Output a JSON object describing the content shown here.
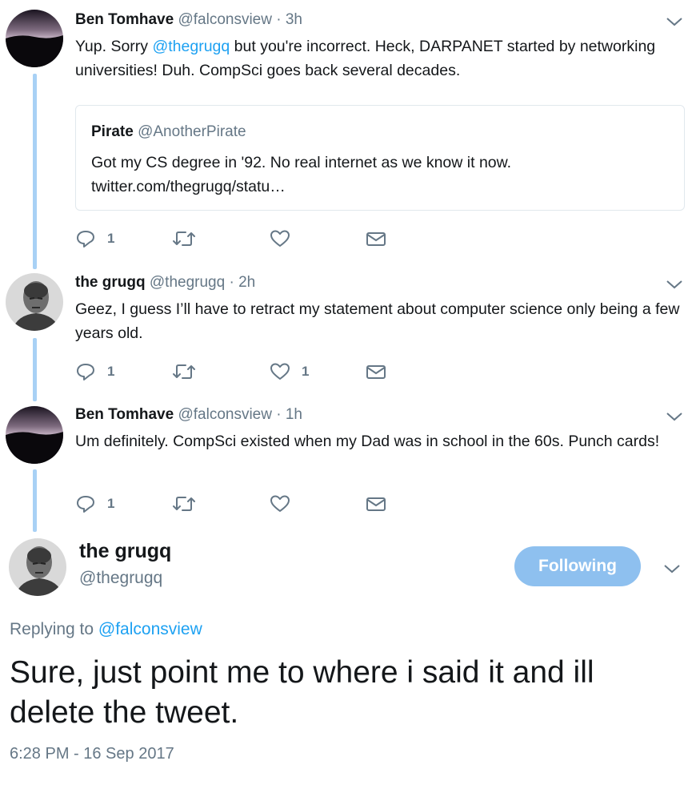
{
  "thread": [
    {
      "name": "Ben Tomhave",
      "handle": "@falconsview",
      "dot": "·",
      "time": "3h",
      "text_before": "Yup. Sorry ",
      "mention": "@thegrugq",
      "text_after": " but you're incorrect. Heck, DARPANET started by networking universities! Duh. CompSci goes back several decades.",
      "quoted": {
        "name": "Pirate",
        "handle": "@AnotherPirate",
        "text": "Got my CS degree in '92. No real internet as we know it now. twitter.com/thegrugq/statu…"
      },
      "actions": {
        "replies": "1",
        "retweets": "",
        "likes": ""
      }
    },
    {
      "name": "the grugq",
      "handle": "@thegrugq",
      "dot": "·",
      "time": "2h",
      "text": "Geez, I guess I’ll have to retract my statement about computer science only being a few years old.",
      "actions": {
        "replies": "1",
        "retweets": "",
        "likes": "1"
      }
    },
    {
      "name": "Ben Tomhave",
      "handle": "@falconsview",
      "dot": "·",
      "time": "1h",
      "text": "Um definitely. CompSci existed when my Dad was in school in the 60s. Punch cards!",
      "actions": {
        "replies": "1",
        "retweets": "",
        "likes": ""
      }
    }
  ],
  "main_tweet": {
    "name": "the grugq",
    "handle": "@thegrugq",
    "follow_label": "Following",
    "replying_prefix": "Replying to ",
    "replying_to": "@falconsview",
    "text": "Sure, just point me to where i said it and ill delete the tweet.",
    "timestamp": "6:28 PM - 16 Sep 2017"
  },
  "icons": {
    "reply": "reply-icon",
    "retweet": "retweet-icon",
    "like": "heart-icon",
    "dm": "envelope-icon",
    "menu": "chevron-down-icon"
  },
  "colors": {
    "link": "#1da1f2",
    "muted": "#657786",
    "thread_line": "#a8d1f5",
    "follow_button": "#8ec0ef"
  }
}
